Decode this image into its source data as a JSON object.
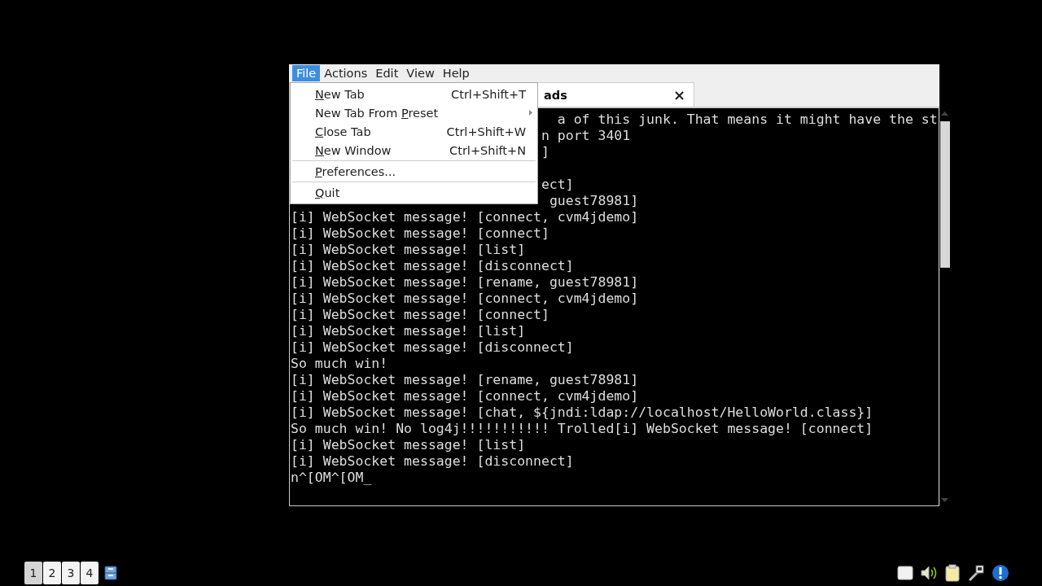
{
  "window": {
    "menubar": [
      {
        "label": "File",
        "selected": true
      },
      {
        "label": "Actions",
        "selected": false
      },
      {
        "label": "Edit",
        "selected": false
      },
      {
        "label": "View",
        "selected": false
      },
      {
        "label": "Help",
        "selected": false
      }
    ],
    "tab": {
      "title": "ads",
      "close": "×"
    },
    "file_menu": [
      {
        "kind": "item",
        "key": "N",
        "after": "ew Tab",
        "shortcut": "Ctrl+Shift+T"
      },
      {
        "kind": "submenu",
        "before": "New Tab From ",
        "key": "P",
        "after": "reset"
      },
      {
        "kind": "item",
        "key": "C",
        "after": "lose Tab",
        "shortcut": "Ctrl+Shift+W"
      },
      {
        "kind": "item",
        "key": "N",
        "after": "ew Window",
        "shortcut": "Ctrl+Shift+N"
      },
      {
        "kind": "separator"
      },
      {
        "kind": "item",
        "key": "P",
        "after": "references..."
      },
      {
        "kind": "separator"
      },
      {
        "kind": "item",
        "key": "Q",
        "after": "uit"
      }
    ],
    "terminal_lines": [
      "a of this junk. That means it might have the st",
      "n port 3401",
      "]",
      {
        "kind": "blank"
      },
      "ect]",
      "guest78981]",
      "[i] WebSocket message! [connect, cvm4jdemo]",
      "[i] WebSocket message! [connect]",
      "[i] WebSocket message! [list]",
      "[i] WebSocket message! [disconnect]",
      "[i] WebSocket message! [rename, guest78981]",
      "[i] WebSocket message! [connect, cvm4jdemo]",
      "[i] WebSocket message! [connect]",
      "[i] WebSocket message! [list]",
      "[i] WebSocket message! [disconnect]",
      "So much win!",
      "[i] WebSocket message! [rename, guest78981]",
      "[i] WebSocket message! [connect, cvm4jdemo]",
      "[i] WebSocket message! [chat, ${jndi:ldap://localhost/HelloWorld.class}]",
      "So much win! No log4j!!!!!!!!!!! Trolled[i] WebSocket message! [connect]",
      "[i] WebSocket message! [list]",
      "[i] WebSocket message! [disconnect]",
      "n^[OM^[OM_"
    ]
  },
  "taskbar": {
    "desktops": [
      {
        "label": "1",
        "selected": true
      },
      {
        "label": "2",
        "selected": false
      },
      {
        "label": "3",
        "selected": false
      },
      {
        "label": "4",
        "selected": false
      }
    ]
  }
}
